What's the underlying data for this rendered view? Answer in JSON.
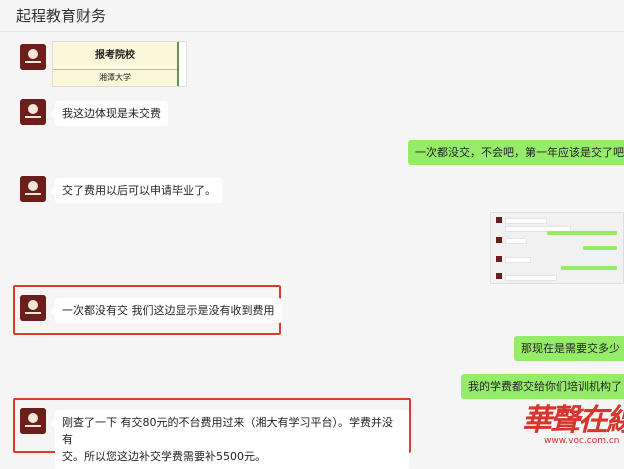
{
  "header": {
    "title": "起程教育财务"
  },
  "messages": {
    "m1_table": {
      "header": "报考院校",
      "value": "湘潭大学"
    },
    "m2": "我这边体现是未交费",
    "m3": "一次都没交，不会吧，第一年应该是交了吧",
    "m4": "交了费用以后可以申请毕业了。",
    "m5": "一次都没有交 我们这边显示是没有收到费用",
    "m6": "那现在是需要交多少",
    "m7": "我的学费都交给你们培训机构了",
    "m8_line1": "刚查了一下 有交80元的不台费用过来（湘大有学习平台）。学费并没有",
    "m8_line2": "交。所以您这边补交学费需要补5500元。"
  },
  "watermark": {
    "logo": "華聲在線",
    "url": "www.voc.com.cn"
  },
  "colors": {
    "right_bubble": "#95ec69",
    "highlight": "#e03a2f",
    "avatar": "#6a1f1a"
  }
}
